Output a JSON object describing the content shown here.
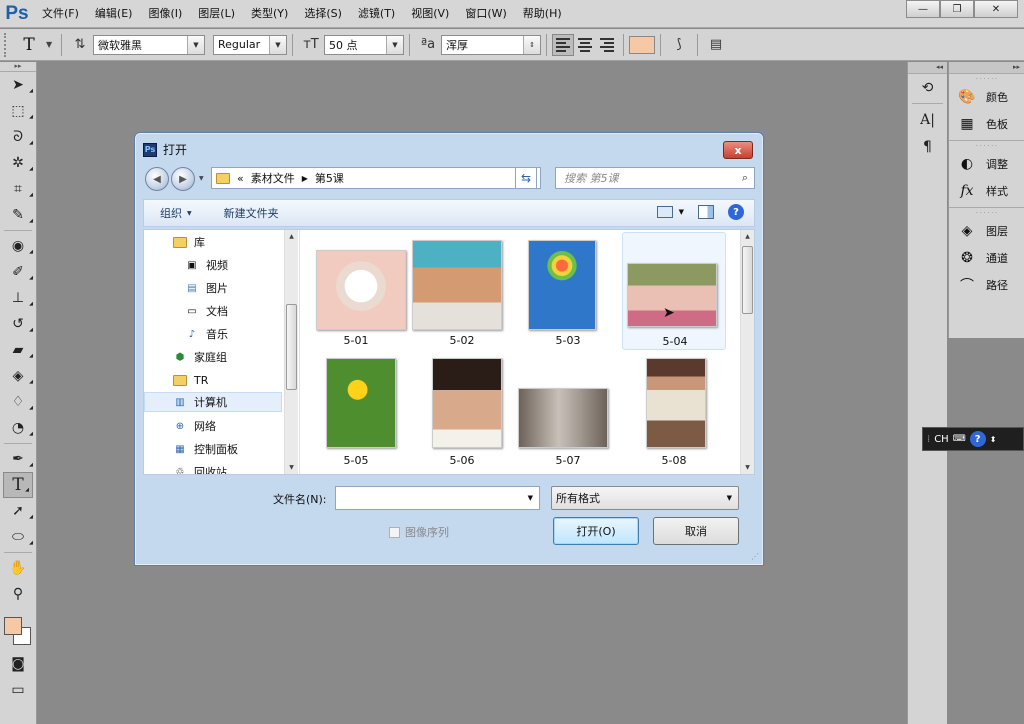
{
  "menubar": {
    "logo": "Ps",
    "items": [
      "文件(F)",
      "编辑(E)",
      "图像(I)",
      "图层(L)",
      "类型(Y)",
      "选择(S)",
      "滤镜(T)",
      "视图(V)",
      "窗口(W)",
      "帮助(H)"
    ],
    "minimize": "—",
    "restore": "❐",
    "close": "✕"
  },
  "options": {
    "tool_glyph": "T",
    "font_family": "微软雅黑",
    "font_style": "Regular",
    "font_size": "50 点",
    "antialias": "浑厚",
    "text_color": "#f5c8a6"
  },
  "toolbox": {
    "foreground": "#f5c8a6",
    "background": "#ffffff"
  },
  "panels": {
    "group1": [
      {
        "label": "颜色",
        "icon": "palette-icon"
      },
      {
        "label": "色板",
        "icon": "swatches-icon"
      }
    ],
    "group2": [
      {
        "label": "调整",
        "icon": "adjustments-icon"
      },
      {
        "label": "样式",
        "icon": "styles-icon"
      }
    ],
    "group3": [
      {
        "label": "图层",
        "icon": "layers-icon"
      },
      {
        "label": "通道",
        "icon": "channels-icon"
      },
      {
        "label": "路径",
        "icon": "paths-icon"
      }
    ]
  },
  "ime": {
    "label": "CH",
    "help": "?"
  },
  "dialog": {
    "title": "打开",
    "close": "x",
    "breadcrumb": {
      "prefix": "«",
      "parent": "素材文件",
      "current": "第5课"
    },
    "search_placeholder": "搜索 第5课",
    "search_icon": "⌕",
    "cmd_organize": "组织",
    "cmd_new_folder": "新建文件夹",
    "help": "?",
    "tree": [
      {
        "label": "库",
        "icon": "library-folder-icon"
      },
      {
        "label": "视频",
        "icon": "video-icon"
      },
      {
        "label": "图片",
        "icon": "pictures-icon"
      },
      {
        "label": "文档",
        "icon": "documents-icon"
      },
      {
        "label": "音乐",
        "icon": "music-icon"
      },
      {
        "label": "家庭组",
        "icon": "homegroup-icon"
      },
      {
        "label": "TR",
        "icon": "user-folder-icon"
      },
      {
        "label": "计算机",
        "icon": "computer-icon"
      },
      {
        "label": "网络",
        "icon": "network-icon"
      },
      {
        "label": "控制面板",
        "icon": "control-panel-icon"
      },
      {
        "label": "回收站",
        "icon": "recycle-bin-icon"
      }
    ],
    "files": [
      "5-01",
      "5-02",
      "5-03",
      "5-04",
      "5-05",
      "5-06",
      "5-07",
      "5-08"
    ],
    "filename_label": "文件名(N):",
    "filename_value": "",
    "filetype": "所有格式",
    "image_sequence": "图像序列",
    "open_button": "打开(O)",
    "cancel_button": "取消"
  }
}
